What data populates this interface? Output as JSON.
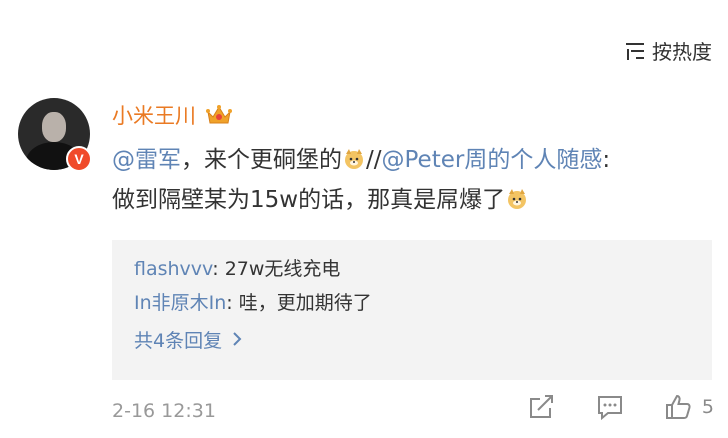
{
  "sort": {
    "label": "按热度",
    "icon": "sort-lines-icon"
  },
  "comment": {
    "username": "小米王川",
    "badge_icon": "crown-icon",
    "verified_label": "V",
    "avatar_icon": "avatar-photo",
    "mention1": "@雷军",
    "text1": "，来个更硐堡的",
    "separator": "//",
    "mention2": "@Peter周的个人随感",
    "text2": ":",
    "text3": "做到隔壁某为15w的话，那真是屌爆了",
    "emoji_icon": "doge-emoji-icon"
  },
  "replies": [
    {
      "user": "flashvvv",
      "text": ": 27w无线充电"
    },
    {
      "user": "In非原木In",
      "text": ": 哇，更加期待了"
    }
  ],
  "more_replies": "共4条回复",
  "timestamp": "2-16 12:31",
  "actions": {
    "share_icon": "share-icon",
    "reply_icon": "comment-icon",
    "like_icon": "thumbs-up-icon",
    "like_count": "5"
  },
  "colors": {
    "username": "#ea7a23",
    "link": "#5f84b5",
    "reply_bg": "#f3f3f3",
    "meta": "#999999"
  }
}
